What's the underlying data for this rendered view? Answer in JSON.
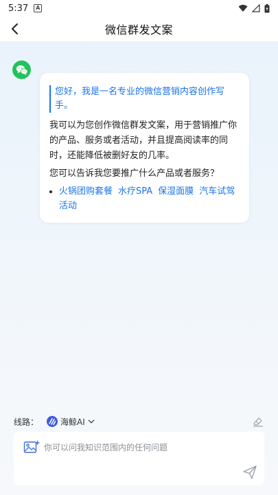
{
  "status_bar": {
    "time": "5:37",
    "notif_letter": "A",
    "icons": [
      "wifi-icon",
      "signal-icon",
      "battery-icon"
    ]
  },
  "header": {
    "title": "微信群发文案",
    "back_icon": "chevron-left-icon"
  },
  "message": {
    "avatar_icon": "wechat-icon",
    "intro": "您好，我是一名专业的微信营销内容创作写手。",
    "paragraph1": "我可以为您创作微信群发文案，用于营销推广你的产品、服务或者活动，并且提高阅读率的同时，还能降低被删好友的几率。",
    "paragraph2": "您可以告诉我您要推广什么产品或者服务？",
    "tags": [
      "火锅团购套餐",
      "水疗SPA",
      "保湿面膜",
      "汽车试驾活动"
    ]
  },
  "route": {
    "label": "线路：",
    "selected": "海鲸AI",
    "clear_icon": "eraser-icon"
  },
  "input": {
    "placeholder": "你可以问我知识范围内的任何问题",
    "value": ""
  },
  "colors": {
    "accent": "#1a73e8",
    "wechat_green": "#22c35a",
    "model_blue": "#3b5bdb"
  }
}
